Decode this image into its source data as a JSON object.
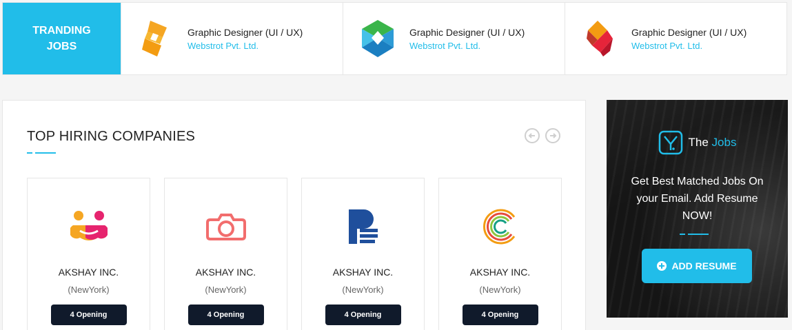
{
  "trending": {
    "label": "TRANDING\nJOBS",
    "jobs": [
      {
        "title": "Graphic Designer (UI / UX)",
        "company": "Webstrot Pvt. Ltd.",
        "logo_icon": "orange-ribbon-logo-icon"
      },
      {
        "title": "Graphic Designer (UI / UX)",
        "company": "Webstrot Pvt. Ltd.",
        "logo_icon": "green-blue-hexagon-logo-icon"
      },
      {
        "title": "Graphic Designer (UI / UX)",
        "company": "Webstrot Pvt. Ltd.",
        "logo_icon": "red-orange-fold-logo-icon"
      }
    ]
  },
  "hiring": {
    "title": "TOP HIRING COMPANIES",
    "companies": [
      {
        "name": "AKSHAY INC.",
        "location": "(NewYork)",
        "openings": "4 Opening",
        "logo_icon": "smiley-face-logo-icon"
      },
      {
        "name": "AKSHAY INC.",
        "location": "(NewYork)",
        "openings": "4 Opening",
        "logo_icon": "camera-logo-icon"
      },
      {
        "name": "AKSHAY INC.",
        "location": "(NewYork)",
        "openings": "4 Opening",
        "logo_icon": "letter-p-logo-icon"
      },
      {
        "name": "AKSHAY INC.",
        "location": "(NewYork)",
        "openings": "4 Opening",
        "logo_icon": "rainbow-c-logo-icon"
      }
    ]
  },
  "resume_widget": {
    "brand_prefix": "The",
    "brand_highlight": "Jobs",
    "text": "Get Best Matched Jobs On your Email. Add Resume NOW!",
    "button_label": "ADD RESUME"
  },
  "colors": {
    "accent": "#21bde9",
    "dark_button": "#101a2b"
  }
}
